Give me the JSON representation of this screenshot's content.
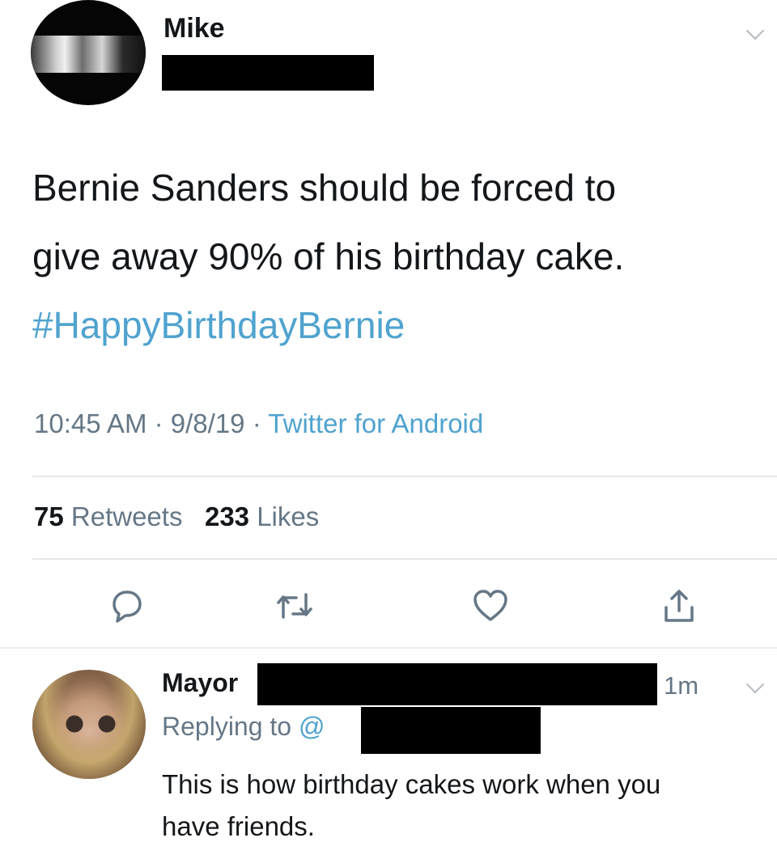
{
  "tweet": {
    "author_name": "Mike",
    "text_lines": [
      "Bernie Sanders should be forced to",
      "give away 90% of his birthday cake."
    ],
    "hashtag": "#HappyBirthdayBernie",
    "time": "10:45 AM",
    "date": "9/8/19",
    "source": "Twitter for Android",
    "retweets_count": "75",
    "retweets_label": "Retweets",
    "likes_count": "233",
    "likes_label": "Likes",
    "icons": {
      "reply": "reply-icon",
      "retweet": "retweet-icon",
      "like": "heart-icon",
      "share": "share-icon",
      "more": "chevron-down-icon"
    }
  },
  "reply": {
    "author_name": "Mayor",
    "time_ago": "1m",
    "replying_label": "Replying to",
    "replying_handle": "@",
    "text_lines": [
      "This is how birthday cakes work when you",
      "have friends."
    ]
  },
  "colors": {
    "link": "#4fa3cf",
    "secondary_text": "#657786",
    "divider": "#e4e7ea"
  }
}
